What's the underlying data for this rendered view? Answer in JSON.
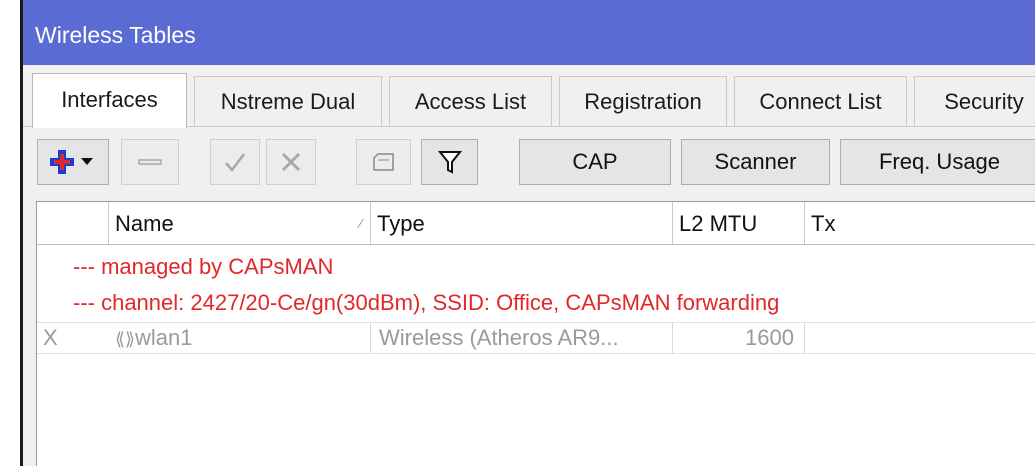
{
  "window": {
    "title": "Wireless Tables"
  },
  "tabs": [
    {
      "label": "Interfaces",
      "active": true
    },
    {
      "label": "Nstreme Dual",
      "active": false
    },
    {
      "label": "Access List",
      "active": false
    },
    {
      "label": "Registration",
      "active": false
    },
    {
      "label": "Connect List",
      "active": false
    },
    {
      "label": "Security",
      "active": false
    }
  ],
  "toolbar": {
    "add_icon": "plus-icon",
    "remove_icon": "minus-icon",
    "enable_icon": "check-icon",
    "disable_icon": "x-icon",
    "comment_icon": "comment-icon",
    "filter_icon": "filter-icon",
    "cap_label": "CAP",
    "scanner_label": "Scanner",
    "freq_usage_label": "Freq. Usage"
  },
  "table": {
    "columns": [
      "Name",
      "Type",
      "L2 MTU",
      "Tx"
    ],
    "comments": [
      "--- managed by CAPsMAN",
      "--- channel: 2427/20-Ce/gn(30dBm), SSID: Office, CAPsMAN forwarding"
    ],
    "rows": [
      {
        "flag": "X",
        "name": "wlan1",
        "type": "Wireless (Atheros AR9...",
        "l2mtu": "1600",
        "tx": ""
      }
    ]
  },
  "colors": {
    "title_bar": "#5a6bd3",
    "comment_text": "#e0282a",
    "add_icon": "#1a3bd8"
  }
}
